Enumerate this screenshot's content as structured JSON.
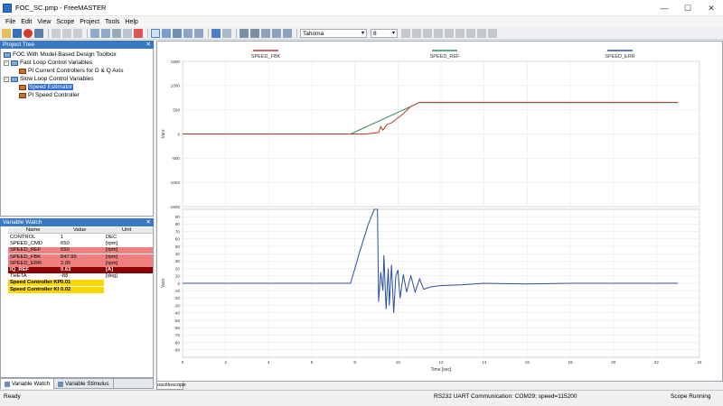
{
  "window": {
    "title": "FOC_SC.pmp - FreeMASTER",
    "minimize": "—",
    "maximize": "☐",
    "close": "✕"
  },
  "menu": [
    "File",
    "Edit",
    "View",
    "Scope",
    "Project",
    "Tools",
    "Help"
  ],
  "toolbar": {
    "font": "Tahoma",
    "size": "8"
  },
  "project_tree": {
    "header": "Project Tree",
    "root": "FOC With Model-Based Design Toolbox",
    "fast_loop": "Fast Loop Control Variables",
    "fast_child": "PI Current Controllers for D & Q Axis",
    "slow_loop": "Slow Loop Control Variables",
    "slow_child_1": "Speed Estimator",
    "slow_child_2": "PI Speed Controller"
  },
  "variable_watch": {
    "header": "Variable Watch",
    "columns": [
      "Name",
      "Value",
      "Unit"
    ],
    "rows": [
      {
        "name": "CONTROL",
        "value": "1",
        "unit": "DEC",
        "bg": "#ffffff",
        "color": "#000000",
        "bold": false
      },
      {
        "name": "SPEED_CMD",
        "value": "650",
        "unit": "[rpm]",
        "bg": "#ffffff",
        "color": "#000000",
        "bold": false
      },
      {
        "name": "SPEED_REF",
        "value": "650",
        "unit": "[rpm]",
        "bg": "#f08080",
        "color": "#000000",
        "bold": false
      },
      {
        "name": "SPEED_FBK",
        "value": "847.95",
        "unit": "[rpm]",
        "bg": "#f08080",
        "color": "#000000",
        "bold": false
      },
      {
        "name": "SPEED_ERR",
        "value": "2.05",
        "unit": "[rpm]",
        "bg": "#f08080",
        "color": "#000000",
        "bold": false
      },
      {
        "name": "IQ_REF",
        "value": "0.63",
        "unit": "[A]",
        "bg": "#8b0000",
        "color": "#ffffff",
        "bold": true
      },
      {
        "name": "THETA",
        "value": "-88",
        "unit": "[deg]",
        "bg": "#ffffff",
        "color": "#000000",
        "bold": false
      },
      {
        "name": "Speed Controller KP",
        "value": "0.01",
        "unit": "",
        "bg": "#ffd700",
        "color": "#000000",
        "bold": true
      },
      {
        "name": "Speed Controller KI",
        "value": "0.02",
        "unit": "",
        "bg": "#ffd700",
        "color": "#000000",
        "bold": true
      }
    ]
  },
  "bottom_tabs": {
    "watch": "Variable Watch",
    "stimulus": "Variable Stimulus"
  },
  "scope_tab": "oscilloscope",
  "status": {
    "ready": "Ready",
    "comm": "RS232 UART Communication: COM29; speed=115200",
    "scope": "Scope Running"
  },
  "chart_data": {
    "type": "line",
    "xlabel": "Time [sec]",
    "xlim": [
      0,
      24
    ],
    "xticks": [
      0,
      2,
      4,
      6,
      8,
      10,
      12,
      14,
      16,
      18,
      20,
      22,
      24
    ],
    "legend": [
      "SPEED_FBK",
      "SPEED_REF",
      "SPEED_ERR"
    ],
    "legend_colors": [
      "#c0392b",
      "#2e8b57",
      "#2a4f9e"
    ],
    "top_plot": {
      "ylabel": "Vars",
      "ylim": [
        -1500,
        1500
      ],
      "yticks": [
        1500,
        1000,
        500,
        0,
        -500,
        -1000,
        -1500
      ],
      "series": [
        {
          "name": "SPEED_REF",
          "color": "#2e8b57",
          "points": [
            [
              0,
              0
            ],
            [
              7.8,
              0
            ],
            [
              11,
              650
            ],
            [
              23,
              650
            ]
          ]
        },
        {
          "name": "SPEED_FBK",
          "color": "#c0392b",
          "points": [
            [
              0,
              0
            ],
            [
              8.5,
              0
            ],
            [
              9.1,
              30
            ],
            [
              9.2,
              150
            ],
            [
              9.3,
              80
            ],
            [
              9.5,
              200
            ],
            [
              9.7,
              230
            ],
            [
              9.9,
              300
            ],
            [
              10.2,
              400
            ],
            [
              10.6,
              570
            ],
            [
              11,
              650
            ],
            [
              23,
              650
            ]
          ]
        }
      ]
    },
    "bottom_plot": {
      "ylabel": "Vars",
      "ylim": [
        -100,
        100
      ],
      "yticks": [
        90,
        80,
        70,
        60,
        50,
        40,
        30,
        20,
        10,
        0,
        -10,
        -20,
        -30,
        -40,
        -50,
        -60,
        -70,
        -80,
        -90
      ],
      "series": [
        {
          "name": "SPEED_ERR",
          "color": "#2a4f9e",
          "points": [
            [
              0,
              0
            ],
            [
              7.8,
              0
            ],
            [
              8.2,
              40
            ],
            [
              8.6,
              78
            ],
            [
              8.9,
              100
            ],
            [
              9.05,
              100
            ],
            [
              9.1,
              -25
            ],
            [
              9.2,
              15
            ],
            [
              9.3,
              -10
            ],
            [
              9.35,
              38
            ],
            [
              9.45,
              -35
            ],
            [
              9.55,
              20
            ],
            [
              9.6,
              -30
            ],
            [
              9.7,
              25
            ],
            [
              9.8,
              -40
            ],
            [
              9.9,
              10
            ],
            [
              10.0,
              18
            ],
            [
              10.1,
              -20
            ],
            [
              10.25,
              12
            ],
            [
              10.4,
              -12
            ],
            [
              10.6,
              10
            ],
            [
              10.8,
              -12
            ],
            [
              11.0,
              6
            ],
            [
              11.2,
              -8
            ],
            [
              11.5,
              -5
            ],
            [
              12,
              -3
            ],
            [
              13,
              -2
            ],
            [
              14,
              0
            ],
            [
              16,
              -1
            ],
            [
              18,
              0
            ],
            [
              20,
              0
            ],
            [
              22,
              0
            ],
            [
              23,
              0
            ]
          ]
        }
      ]
    }
  }
}
